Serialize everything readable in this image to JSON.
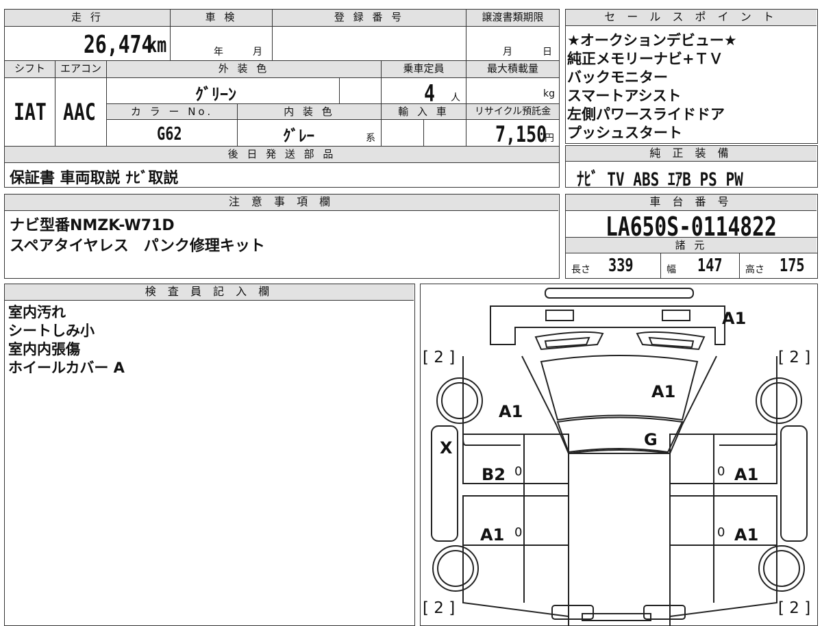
{
  "vehicle": {
    "mileage_label": "走 行",
    "mileage_value": "26,474",
    "mileage_unit": "km",
    "inspection_label": "車 検",
    "inspection_year": "年",
    "inspection_month": "月",
    "reg_number_label": "登 録 番 号",
    "transfer_deadline_label": "譲渡書類期限",
    "transfer_month": "月",
    "transfer_day": "日",
    "shift_label": "シフト",
    "shift_value": "IAT",
    "aircon_label": "エアコン",
    "aircon_value": "AAC",
    "exterior_color_label": "外 装 色",
    "exterior_color_value": "ｸﾞﾘｰﾝ",
    "capacity_label": "乗車定員",
    "capacity_value": "4",
    "capacity_unit": "人",
    "max_load_label": "最大積載量",
    "max_load_unit": "kg",
    "color_no_label": "カ ラ ー No.",
    "color_no_value": "G62",
    "interior_color_label": "内 装 色",
    "interior_color_value": "ｸﾞﾚｰ",
    "interior_color_suffix": "系",
    "import_label": "輸 入 車",
    "recycle_label": "リサイクル預託金",
    "recycle_value": "7,150",
    "recycle_unit": "円",
    "later_parts_label": "後 日 発 送 部 品",
    "later_parts_value": "保証書 車両取説 ﾅﾋﾞ取説"
  },
  "sales_points": {
    "label": "セ ー ル ス ポ イ ン ト",
    "items": [
      "★オークションデビュー★",
      "純正メモリーナビ+ＴＶ",
      "バックモニター",
      "スマートアシスト",
      "左側パワースライドドア",
      "プッシュスタート"
    ]
  },
  "equipment": {
    "label": "純 正 装 備",
    "value": "ﾅﾋﾞ TV ABS ｴｱB PS PW"
  },
  "notes": {
    "label": "注 意 事 項 欄",
    "lines": [
      "ナビ型番NMZK-W71D",
      "スペアタイヤレス　パンク修理キット"
    ]
  },
  "chassis": {
    "label": "車 台 番 号",
    "value": "LA650S-0114822",
    "specs_label": "諸 元",
    "length_label": "長さ",
    "length_value": "339",
    "width_label": "幅",
    "width_value": "147",
    "height_label": "高さ",
    "height_value": "175"
  },
  "inspector": {
    "label": "検 査 員 記 入 欄",
    "lines": [
      "室内汚れ",
      "シートしみ小",
      "室内内張傷",
      "ホイールカバー A"
    ]
  },
  "diagram": {
    "marks": {
      "top_right": "A1",
      "front_left": "A1",
      "hood": "A1",
      "windshield": "G",
      "left_side": "X",
      "front_left_door": "B2",
      "rear_left_door": "A1",
      "front_right_door": "A1",
      "rear_right_door": "A1",
      "tire_tl": "[ 2 ]",
      "tire_tr": "[ 2 ]",
      "tire_bl": "[ 2 ]",
      "tire_br": "[ 2 ]",
      "zero": "0"
    }
  }
}
